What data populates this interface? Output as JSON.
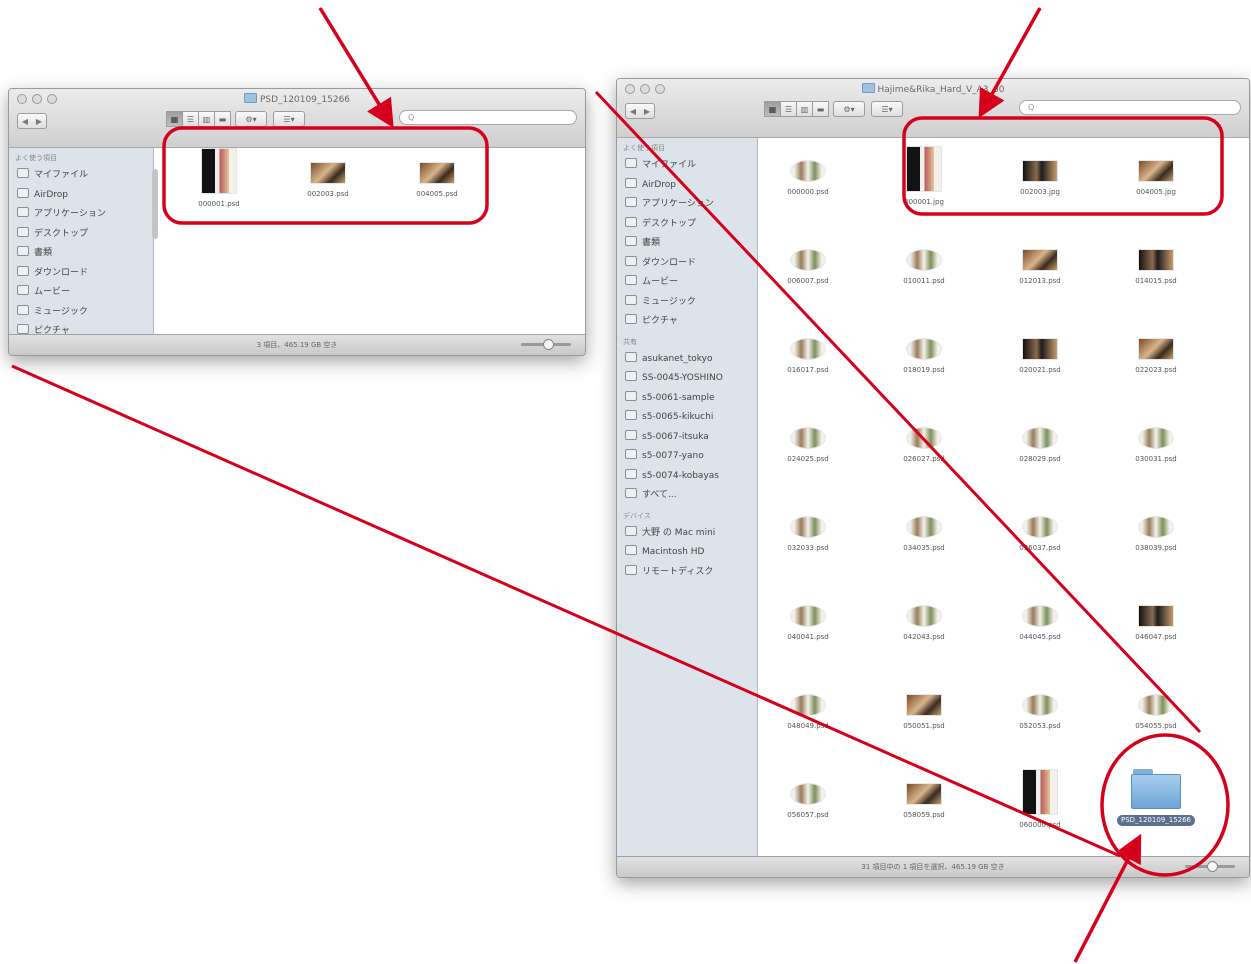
{
  "colors": {
    "annotation_red": "#d6001c"
  },
  "left_window": {
    "title": "PSD_120109_15266",
    "toolbar": {
      "view_icons": [
        "grid-view-icon",
        "list-view-icon",
        "column-view-icon",
        "coverflow-view-icon"
      ],
      "action": "⚙▾",
      "arrange": "☰▾",
      "search_placeholder": "Q"
    },
    "sidebar": {
      "header": "よく使う項目",
      "items": [
        {
          "label": "マイファイル",
          "icon": "my-files-icon"
        },
        {
          "label": "AirDrop",
          "icon": "airdrop-icon"
        },
        {
          "label": "アプリケーション",
          "icon": "applications-icon"
        },
        {
          "label": "デスクトップ",
          "icon": "desktop-icon"
        },
        {
          "label": "書類",
          "icon": "documents-icon"
        },
        {
          "label": "ダウンロード",
          "icon": "downloads-icon"
        },
        {
          "label": "ムービー",
          "icon": "movies-icon"
        },
        {
          "label": "ミュージック",
          "icon": "music-icon"
        },
        {
          "label": "ピクチャ",
          "icon": "pictures-icon"
        }
      ]
    },
    "files": [
      {
        "name": "000001.psd",
        "kind": "portrait"
      },
      {
        "name": "002003.psd",
        "kind": "pair"
      },
      {
        "name": "004005.psd",
        "kind": "pair"
      }
    ],
    "status": "3 項目、465.19 GB 空き"
  },
  "right_window": {
    "title": "Hajime&Rika_Hard_V_A3_60",
    "toolbar": {
      "action": "⚙▾",
      "arrange": "☰▾",
      "search_placeholder": "Q"
    },
    "sidebar": {
      "favorites_header": "よく使う項目",
      "favorites": [
        {
          "label": "マイファイル",
          "icon": "my-files-icon"
        },
        {
          "label": "AirDrop",
          "icon": "airdrop-icon"
        },
        {
          "label": "アプリケーション",
          "icon": "applications-icon"
        },
        {
          "label": "デスクトップ",
          "icon": "desktop-icon"
        },
        {
          "label": "書類",
          "icon": "documents-icon"
        },
        {
          "label": "ダウンロード",
          "icon": "downloads-icon"
        },
        {
          "label": "ムービー",
          "icon": "movies-icon"
        },
        {
          "label": "ミュージック",
          "icon": "music-icon"
        },
        {
          "label": "ピクチャ",
          "icon": "pictures-icon"
        }
      ],
      "shared_header": "共有",
      "shared": [
        {
          "label": "asukanet_tokyo",
          "icon": "server-icon"
        },
        {
          "label": "SS-0045-YOSHINO",
          "icon": "server-icon"
        },
        {
          "label": "s5-0061-sample",
          "icon": "server-icon"
        },
        {
          "label": "s5-0065-kikuchi",
          "icon": "server-icon"
        },
        {
          "label": "s5-0067-itsuka",
          "icon": "server-icon"
        },
        {
          "label": "s5-0077-yano",
          "icon": "server-icon"
        },
        {
          "label": "s5-0074-kobayas",
          "icon": "server-icon"
        },
        {
          "label": "すべて...",
          "icon": "network-icon"
        }
      ],
      "devices_header": "デバイス",
      "devices": [
        {
          "label": "大野 の Mac mini",
          "icon": "mac-mini-icon"
        },
        {
          "label": "Macintosh HD",
          "icon": "hard-disk-icon"
        },
        {
          "label": "リモートディスク",
          "icon": "remote-disc-icon"
        }
      ]
    },
    "files": [
      {
        "name": "000000.psd",
        "kind": "pair light"
      },
      {
        "name": "000001.jpg",
        "kind": "portrait"
      },
      {
        "name": "002003.jpg",
        "kind": "pair dark"
      },
      {
        "name": "004005.jpg",
        "kind": "pair"
      },
      {
        "name": "006007.psd",
        "kind": "pair light"
      },
      {
        "name": "010011.psd",
        "kind": "pair light"
      },
      {
        "name": "012013.psd",
        "kind": "pair"
      },
      {
        "name": "014015.psd",
        "kind": "pair dark"
      },
      {
        "name": "016017.psd",
        "kind": "pair light"
      },
      {
        "name": "018019.psd",
        "kind": "pair light"
      },
      {
        "name": "020021.psd",
        "kind": "pair dark"
      },
      {
        "name": "022023.psd",
        "kind": "pair"
      },
      {
        "name": "024025.psd",
        "kind": "pair light"
      },
      {
        "name": "026027.psd",
        "kind": "pair light"
      },
      {
        "name": "028029.psd",
        "kind": "pair light"
      },
      {
        "name": "030031.psd",
        "kind": "pair light"
      },
      {
        "name": "032033.psd",
        "kind": "pair light"
      },
      {
        "name": "034035.psd",
        "kind": "pair light"
      },
      {
        "name": "036037.psd",
        "kind": "pair light"
      },
      {
        "name": "038039.psd",
        "kind": "pair light"
      },
      {
        "name": "040041.psd",
        "kind": "pair light"
      },
      {
        "name": "042043.psd",
        "kind": "pair light"
      },
      {
        "name": "044045.psd",
        "kind": "pair light"
      },
      {
        "name": "046047.psd",
        "kind": "pair dark"
      },
      {
        "name": "048049.psd",
        "kind": "pair light"
      },
      {
        "name": "050051.psd",
        "kind": "pair"
      },
      {
        "name": "052053.psd",
        "kind": "pair light"
      },
      {
        "name": "054055.psd",
        "kind": "pair light"
      },
      {
        "name": "056057.psd",
        "kind": "pair light"
      },
      {
        "name": "058059.psd",
        "kind": "pair"
      },
      {
        "name": "060000.psd",
        "kind": "portrait"
      },
      {
        "name": "PSD_120109_15266",
        "kind": "folder"
      }
    ],
    "status": "31 項目中の 1 項目を選択、465.19 GB 空き"
  }
}
